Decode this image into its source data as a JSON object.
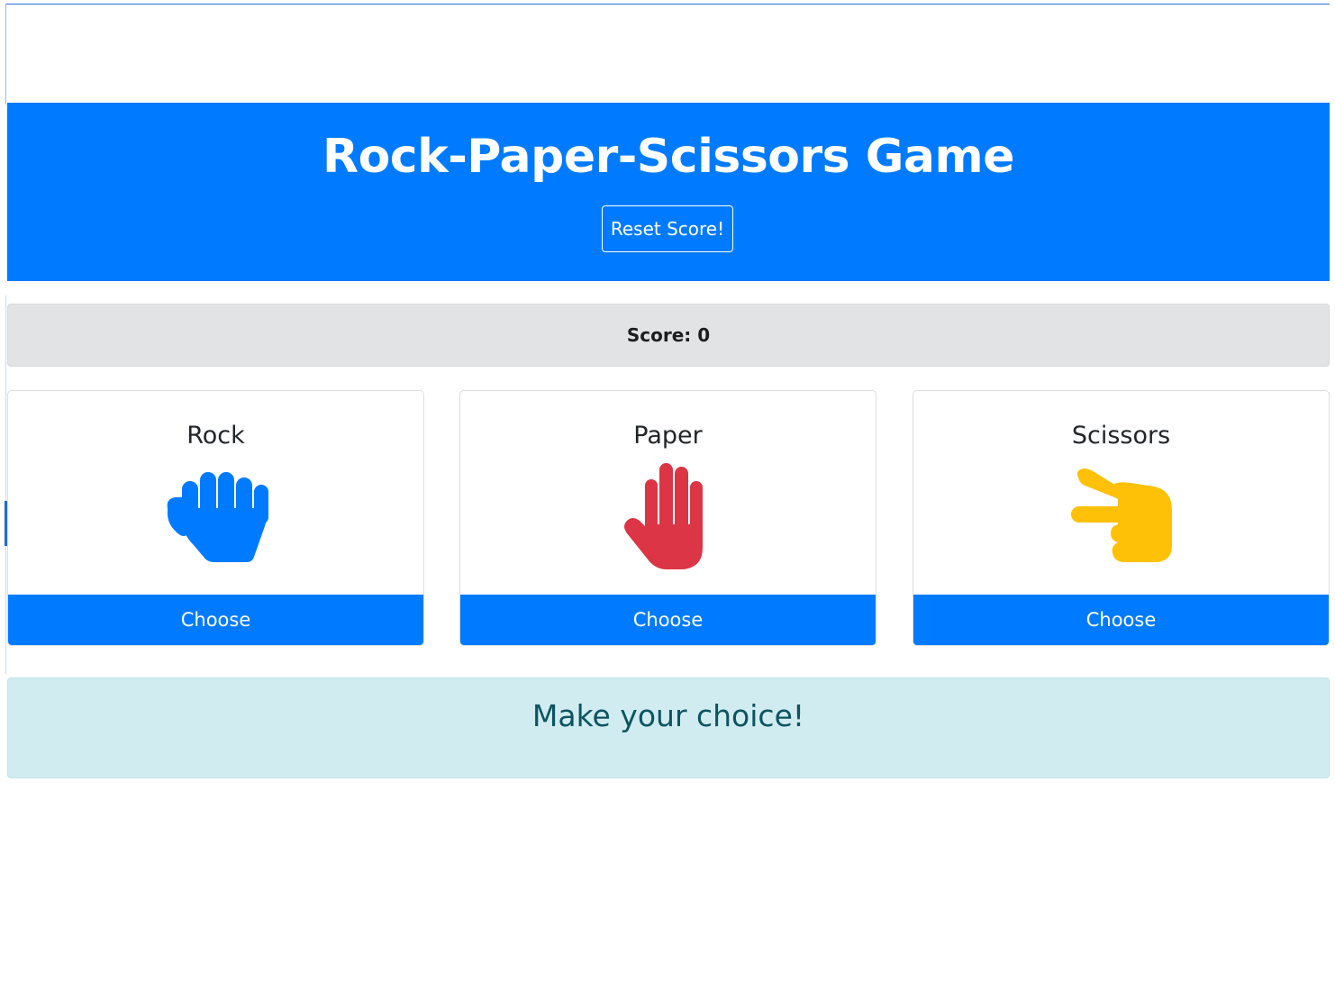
{
  "header": {
    "title": "Rock-Paper-Scissors Game",
    "reset_label": "Reset Score!"
  },
  "score": {
    "label": "Score: 0"
  },
  "choices": [
    {
      "name": "Rock",
      "button_label": "Choose",
      "icon": "fist-icon",
      "color": "#007bff"
    },
    {
      "name": "Paper",
      "button_label": "Choose",
      "icon": "open-hand-icon",
      "color": "#dc3545"
    },
    {
      "name": "Scissors",
      "button_label": "Choose",
      "icon": "scissors-hand-icon",
      "color": "#ffc107"
    }
  ],
  "result": {
    "message": "Make your choice!"
  },
  "colors": {
    "primary": "#007bff",
    "danger": "#dc3545",
    "warning": "#ffc107",
    "info_bg": "#d1ecf1",
    "info_text": "#0c5460",
    "score_bg": "#e2e3e5"
  }
}
